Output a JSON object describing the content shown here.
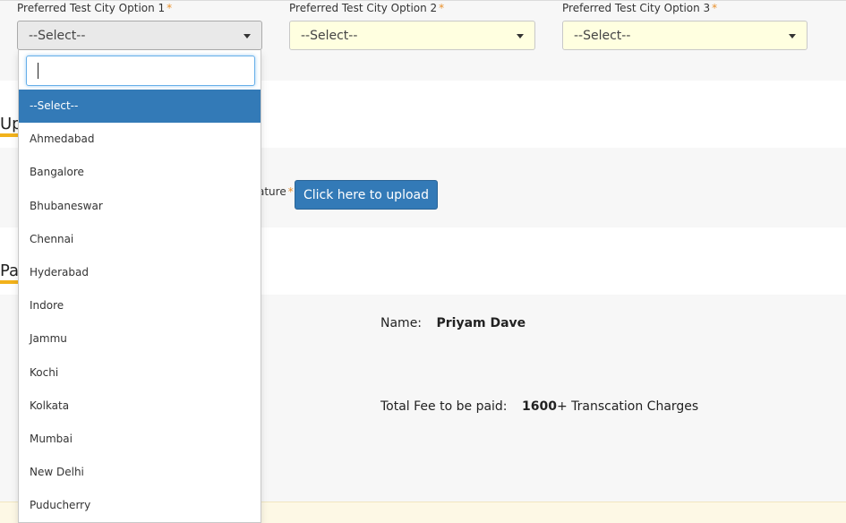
{
  "form": {
    "required_marker": "*",
    "city_options": [
      {
        "label": "Preferred Test City Option 1",
        "value": "--Select--"
      },
      {
        "label": "Preferred Test City Option 2",
        "value": "--Select--"
      },
      {
        "label": "Preferred Test City Option 3",
        "value": "--Select--"
      }
    ]
  },
  "dropdown": {
    "search_value": "",
    "items": [
      "--Select--",
      "Ahmedabad",
      "Bangalore",
      "Bhubaneswar",
      "Chennai",
      "Hyderabad",
      "Indore",
      "Jammu",
      "Kochi",
      "Kolkata",
      "Mumbai",
      "New Delhi",
      "Puducherry"
    ],
    "highlighted": "--Select--"
  },
  "upload_section": {
    "heading_partial": "Up",
    "signature_label_partial": "ature",
    "upload_button": "Click here to upload"
  },
  "payment_section": {
    "heading_partial": "Pa",
    "name_label": "Name:",
    "name_value": "Priyam Dave",
    "fee_label": "Total Fee to be paid:",
    "fee_amount": "1600",
    "fee_suffix": "+ Transcation Charges"
  },
  "colors": {
    "accent_underline": "#f2b21b",
    "button_blue": "#337ab7",
    "required_orange": "#e8912d",
    "select_bg": "#ffffe0"
  }
}
